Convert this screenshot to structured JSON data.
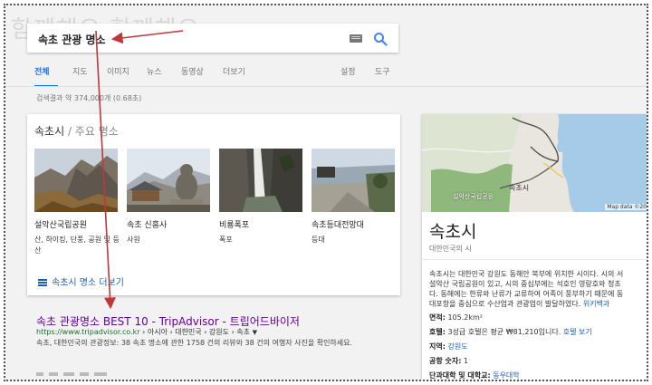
{
  "watermark": "함께해요 함께해요",
  "search": {
    "query": "속초 관광 명소",
    "keyboard_icon": "keyboard-icon",
    "search_icon": "search-icon"
  },
  "tabs": {
    "items": [
      {
        "label": "전체",
        "active": true
      },
      {
        "label": "지도"
      },
      {
        "label": "이미지"
      },
      {
        "label": "뉴스"
      },
      {
        "label": "동영상"
      },
      {
        "label": "더보기"
      }
    ],
    "settings": "설정",
    "tools": "도구"
  },
  "result_stats": "검색결과 약 374,000개 (0.68초)",
  "places": {
    "title_main": "속초시",
    "title_sep": " / ",
    "title_sub": "주요 명소",
    "items": [
      {
        "name": "설악산국립공원",
        "desc": "산, 하이킹, 단풍, 공원 및 등산"
      },
      {
        "name": "속초 신흥사",
        "desc": "사원"
      },
      {
        "name": "비룡폭포",
        "desc": "폭포"
      },
      {
        "name": "속초등대전망대",
        "desc": "등대"
      }
    ],
    "more_link": "속초시 명소 더보기"
  },
  "result": {
    "title": "속초 관광명소 BEST 10 - TripAdvisor - 트립어드바이저",
    "url_host": "https://www.tripadvisor.co.kr",
    "url_crumbs": " › 아시아 › 대한민국 › 강원도 › 속초 ",
    "url_caret": "▼",
    "snippet": "속초, 대한민국의 관광정보: 38 속초 명소에 관한 1758 건의 리뷰와 38 건의 여행자 사진을 확인하세요."
  },
  "knowledge_panel": {
    "map_city_label": "속초시",
    "map_park_label": "설악산국립공원",
    "map_attribution": "Map data ©20",
    "title": "속초시",
    "subtitle": "대한민국의 시",
    "desc_lines": [
      "속초시는 대한민국 강원도 동해안 북부에 위치한 시이다. 시의 서",
      "설악산 국립공원이 있고, 시의 중심부에는 석호인 영랑호와 청초",
      "다. 동해에는 한류와 난류가 교류하여 어족이 풍부하기 때문에 동",
      "대포항을 중심으로 수산업과 관광업이 발달하였다."
    ],
    "desc_link": "위키백과",
    "facts": [
      {
        "label": "면적:",
        "value": "105.2km²"
      },
      {
        "label": "호텔:",
        "value": "3성급 호텔은 평균 ₩81,210입니다. ",
        "link": "호텔 보기"
      },
      {
        "label": "지역:",
        "link": "강원도"
      },
      {
        "label": "공항 숫자:",
        "value": "1"
      },
      {
        "label": "단과대학 및 대학교:",
        "link": "동우대학"
      }
    ]
  },
  "colors": {
    "accent": "#1a73e8",
    "link": "#1a5fb4",
    "visited": "#660099",
    "url": "#1a6b2e",
    "arrow": "#c0363a"
  }
}
